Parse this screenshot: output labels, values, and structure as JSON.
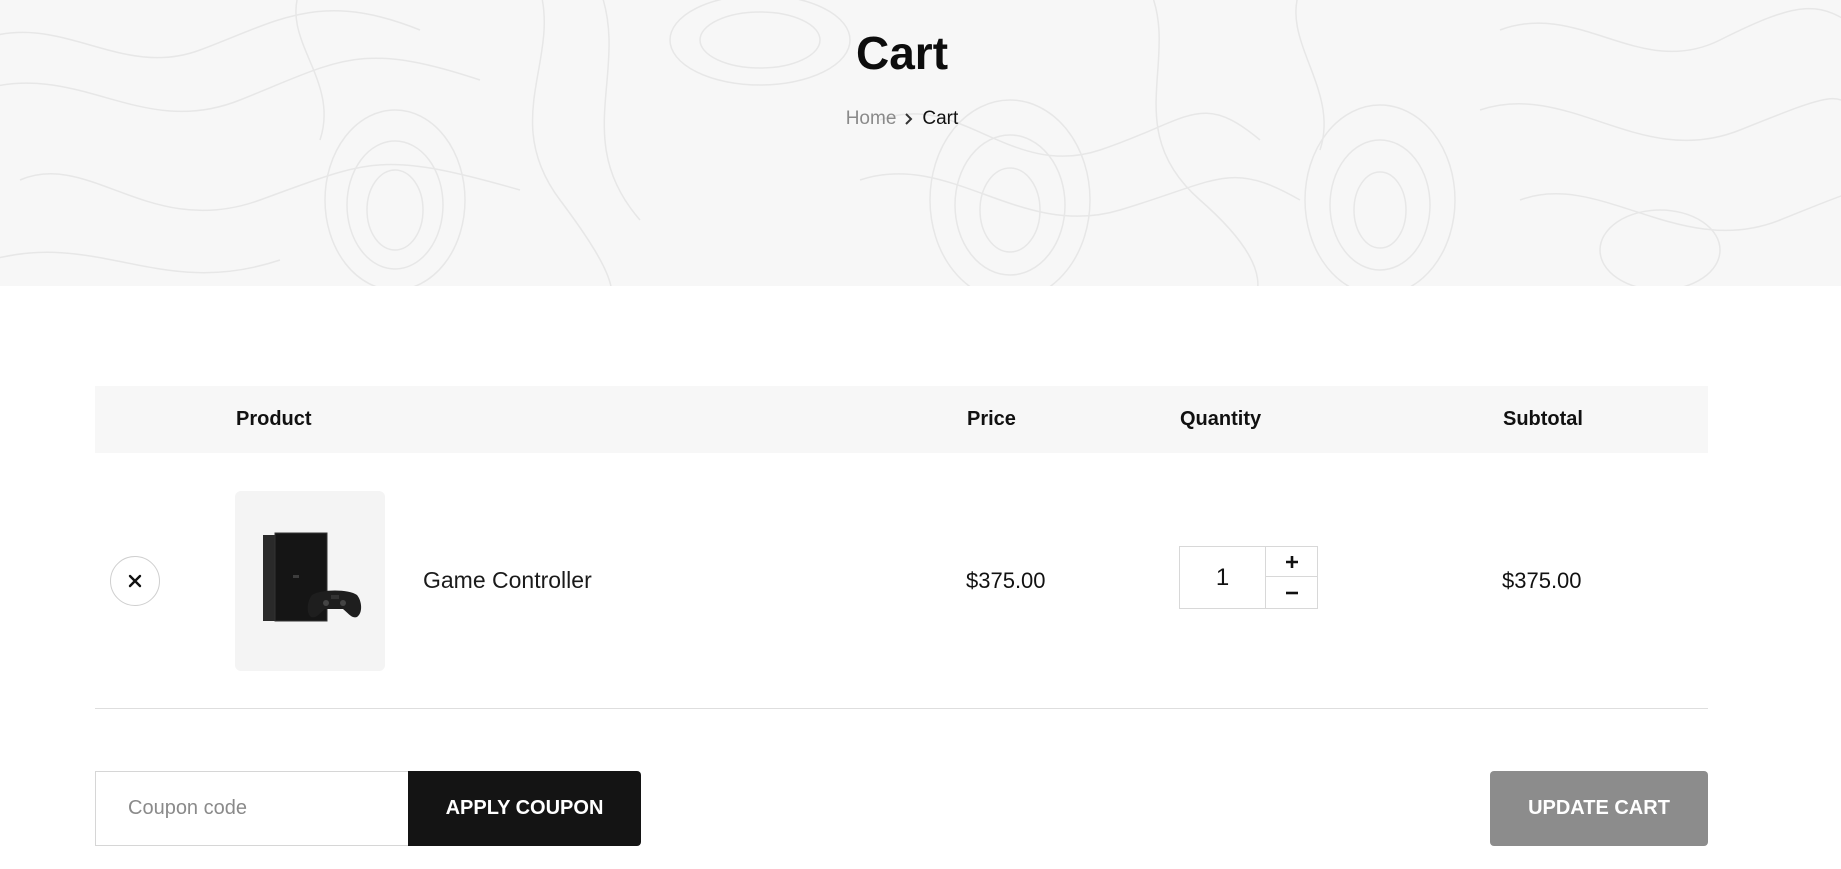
{
  "hero": {
    "title": "Cart",
    "breadcrumb": {
      "home": "Home",
      "current": "Cart"
    }
  },
  "table": {
    "headers": {
      "product": "Product",
      "price": "Price",
      "quantity": "Quantity",
      "subtotal": "Subtotal"
    },
    "rows": [
      {
        "name": "Game Controller",
        "price": "$375.00",
        "quantity": "1",
        "subtotal": "$375.00",
        "image_icon": "game-console-image"
      }
    ]
  },
  "coupon": {
    "placeholder": "Coupon code",
    "apply_label": "APPLY COUPON"
  },
  "actions": {
    "update_label": "UPDATE CART"
  },
  "colors": {
    "hero_bg": "#f7f7f7",
    "header_bg": "#f7f7f7",
    "apply_button": "#141414",
    "update_button": "#8c8c8c"
  }
}
